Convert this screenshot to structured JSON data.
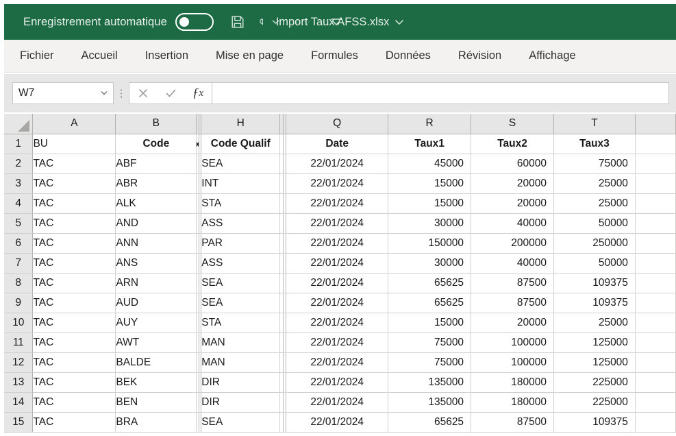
{
  "titlebar": {
    "autosave_label": "Enregistrement automatique",
    "autosave_state": "off",
    "save_icon": "save-floppy-icon",
    "undo_icon": "undo-icon",
    "redo_icon": "redo-icon",
    "customize_icon": "customize-quick-access-toolbar-icon",
    "document_title": "Import Taux AFSS.xlsx",
    "title_caret": "chevron-down-icon",
    "background": "#1d6b45"
  },
  "ribbon": {
    "tabs": [
      {
        "label": "Fichier"
      },
      {
        "label": "Accueil"
      },
      {
        "label": "Insertion"
      },
      {
        "label": "Mise en page"
      },
      {
        "label": "Formules"
      },
      {
        "label": "Données"
      },
      {
        "label": "Révision"
      },
      {
        "label": "Affichage"
      }
    ]
  },
  "formulabar": {
    "name_box_value": "W7",
    "name_box_caret": "chevron-down-icon",
    "cancel_icon": "close-x-icon",
    "confirm_icon": "checkmark-icon",
    "function_icon": "fx-insert-function-icon",
    "formula_value": "",
    "formula_placeholder": ""
  },
  "grid": {
    "column_headers": [
      "A",
      "B",
      "H",
      "Q",
      "R",
      "S",
      "T"
    ],
    "header_row": {
      "number": "1",
      "cells": [
        "BU",
        "Code",
        "Code Qualif",
        "Date",
        "Taux1",
        "Taux2",
        "Taux3"
      ]
    },
    "hidden_column_markers": 4,
    "rows": [
      {
        "n": "2",
        "bu": "TAC",
        "code": "ABF",
        "qualif": "SEA",
        "date": "22/01/2024",
        "taux1": "45000",
        "taux2": "60000",
        "taux3": "75000"
      },
      {
        "n": "3",
        "bu": "TAC",
        "code": "ABR",
        "qualif": "INT",
        "date": "22/01/2024",
        "taux1": "15000",
        "taux2": "20000",
        "taux3": "25000"
      },
      {
        "n": "4",
        "bu": "TAC",
        "code": "ALK",
        "qualif": "STA",
        "date": "22/01/2024",
        "taux1": "15000",
        "taux2": "20000",
        "taux3": "25000"
      },
      {
        "n": "5",
        "bu": "TAC",
        "code": "AND",
        "qualif": "ASS",
        "date": "22/01/2024",
        "taux1": "30000",
        "taux2": "40000",
        "taux3": "50000"
      },
      {
        "n": "6",
        "bu": "TAC",
        "code": "ANN",
        "qualif": "PAR",
        "date": "22/01/2024",
        "taux1": "150000",
        "taux2": "200000",
        "taux3": "250000"
      },
      {
        "n": "7",
        "bu": "TAC",
        "code": "ANS",
        "qualif": "ASS",
        "date": "22/01/2024",
        "taux1": "30000",
        "taux2": "40000",
        "taux3": "50000"
      },
      {
        "n": "8",
        "bu": "TAC",
        "code": "ARN",
        "qualif": "SEA",
        "date": "22/01/2024",
        "taux1": "65625",
        "taux2": "87500",
        "taux3": "109375"
      },
      {
        "n": "9",
        "bu": "TAC",
        "code": "AUD",
        "qualif": "SEA",
        "date": "22/01/2024",
        "taux1": "65625",
        "taux2": "87500",
        "taux3": "109375"
      },
      {
        "n": "10",
        "bu": "TAC",
        "code": "AUY",
        "qualif": "STA",
        "date": "22/01/2024",
        "taux1": "15000",
        "taux2": "20000",
        "taux3": "25000"
      },
      {
        "n": "11",
        "bu": "TAC",
        "code": "AWT",
        "qualif": "MAN",
        "date": "22/01/2024",
        "taux1": "75000",
        "taux2": "100000",
        "taux3": "125000"
      },
      {
        "n": "12",
        "bu": "TAC",
        "code": "BALDE",
        "qualif": "MAN",
        "date": "22/01/2024",
        "taux1": "75000",
        "taux2": "100000",
        "taux3": "125000"
      },
      {
        "n": "13",
        "bu": "TAC",
        "code": "BEK",
        "qualif": "DIR",
        "date": "22/01/2024",
        "taux1": "135000",
        "taux2": "180000",
        "taux3": "225000"
      },
      {
        "n": "14",
        "bu": "TAC",
        "code": "BEN",
        "qualif": "DIR",
        "date": "22/01/2024",
        "taux1": "135000",
        "taux2": "180000",
        "taux3": "225000"
      },
      {
        "n": "15",
        "bu": "TAC",
        "code": "BRA",
        "qualif": "SEA",
        "date": "22/01/2024",
        "taux1": "65625",
        "taux2": "87500",
        "taux3": "109375"
      }
    ]
  }
}
